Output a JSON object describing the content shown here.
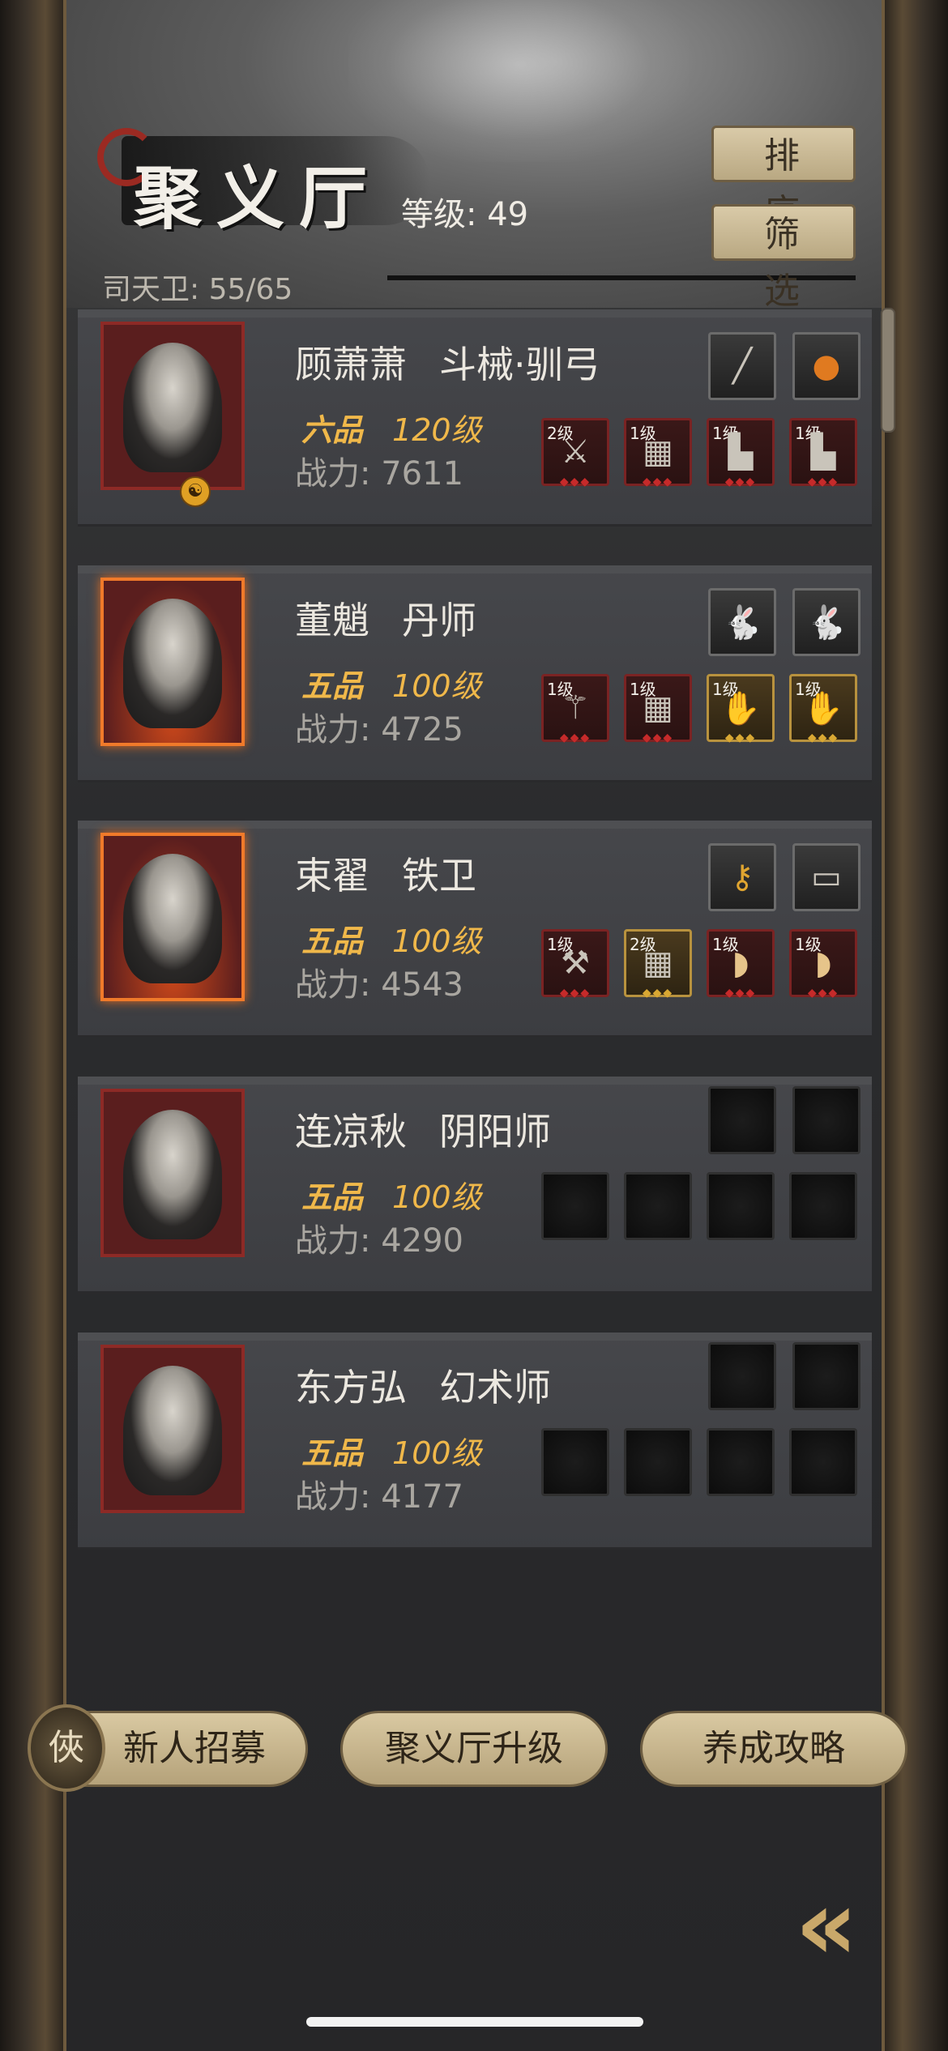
{
  "header": {
    "title": "聚义厅",
    "level_text": "等级: 49",
    "guard_count": "司天卫: 55/65",
    "sort_label": "排序",
    "filter_label": "筛选"
  },
  "heroes": [
    {
      "name": "顾萧萧",
      "job": "斗械·驯弓",
      "grade": "六品",
      "level": "120级",
      "power": "战力: 7611",
      "slots": [
        "2级",
        "1级",
        "1级",
        "1级"
      ]
    },
    {
      "name": "董魈",
      "job": "丹师",
      "grade": "五品",
      "level": "100级",
      "power": "战力: 4725",
      "slots": [
        "1级",
        "1级",
        "1级",
        "1级"
      ]
    },
    {
      "name": "束翟",
      "job": "铁卫",
      "grade": "五品",
      "level": "100级",
      "power": "战力: 4543",
      "slots": [
        "1级",
        "2级",
        "1级",
        "1级"
      ]
    },
    {
      "name": "连凉秋",
      "job": "阴阳师",
      "grade": "五品",
      "level": "100级",
      "power": "战力: 4290"
    },
    {
      "name": "东方弘",
      "job": "幻术师",
      "grade": "五品",
      "level": "100级",
      "power": "战力: 4177"
    }
  ],
  "bottom": {
    "recruit_label": "新人招募",
    "upgrade_label": "聚义厅升级",
    "guide_label": "养成攻略"
  },
  "icons": {
    "recruit": "recruit-token-icon",
    "back": "double-chevron-left-icon"
  }
}
